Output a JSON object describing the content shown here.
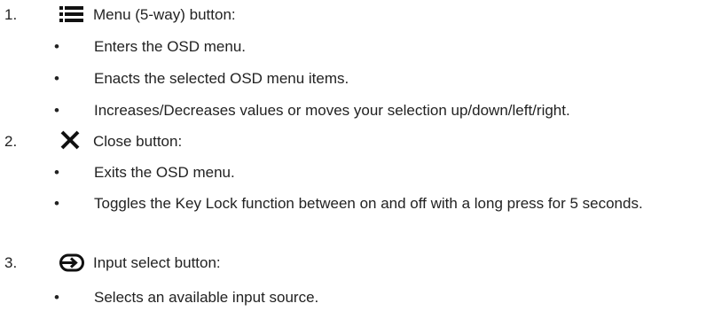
{
  "items": [
    {
      "number": "1.",
      "icon": "menu-icon",
      "label": "Menu (5-way) button:",
      "bullets": [
        "Enters the OSD menu.",
        "Enacts the selected OSD menu items.",
        "Increases/Decreases values or moves your selection up/down/left/right."
      ]
    },
    {
      "number": "2.",
      "icon": "close-icon",
      "label": "Close button:",
      "bullets": [
        "Exits the OSD menu.",
        "Toggles the Key Lock function between on and off with a long press for 5 seconds."
      ]
    },
    {
      "number": "3.",
      "icon": "input-select-icon",
      "label": "Input select button:",
      "bullets": [
        "Selects an available input source."
      ]
    }
  ],
  "bullet_glyph": "•"
}
